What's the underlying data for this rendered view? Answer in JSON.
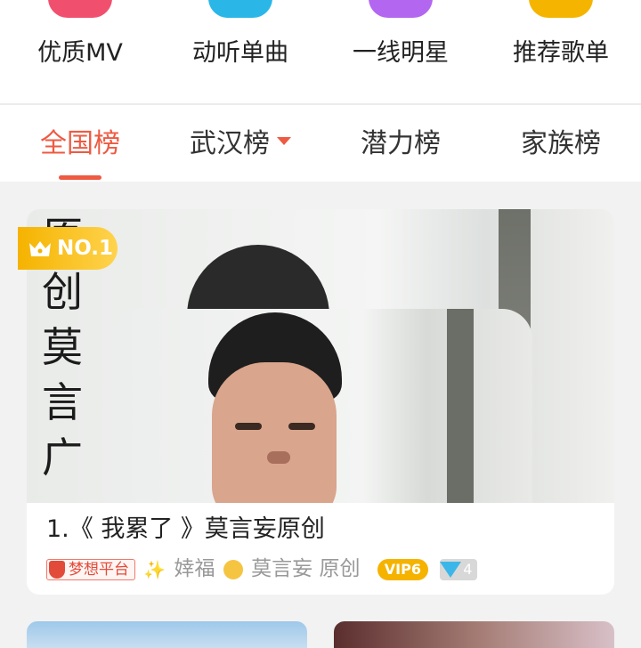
{
  "categories": [
    {
      "label": "优质MV",
      "icon": "mv-icon",
      "color": "#f0506e"
    },
    {
      "label": "动听单曲",
      "icon": "music-note-icon",
      "color": "#2ab7e8"
    },
    {
      "label": "一线明星",
      "icon": "star-icon",
      "color": "#b366f0"
    },
    {
      "label": "推荐歌单",
      "icon": "playlist-icon",
      "color": "#f5b400"
    }
  ],
  "tabs": [
    {
      "label": "全国榜",
      "active": true
    },
    {
      "label": "武汉榜",
      "dropdown": true
    },
    {
      "label": "潜力榜"
    },
    {
      "label": "家族榜"
    }
  ],
  "feature_card": {
    "rank_badge": "NO.1",
    "cover_calligraphy": "原创莫言广",
    "title": "1.《 我累了 》莫言妄原创",
    "platform_tag": "梦想平台",
    "artist_prefix": "婞福",
    "artist_name": "莫言妄 原创",
    "vip_level": "VIP6",
    "diamond_count": "4"
  },
  "colors": {
    "accent": "#ee5a42",
    "badge": "#f5b300"
  }
}
